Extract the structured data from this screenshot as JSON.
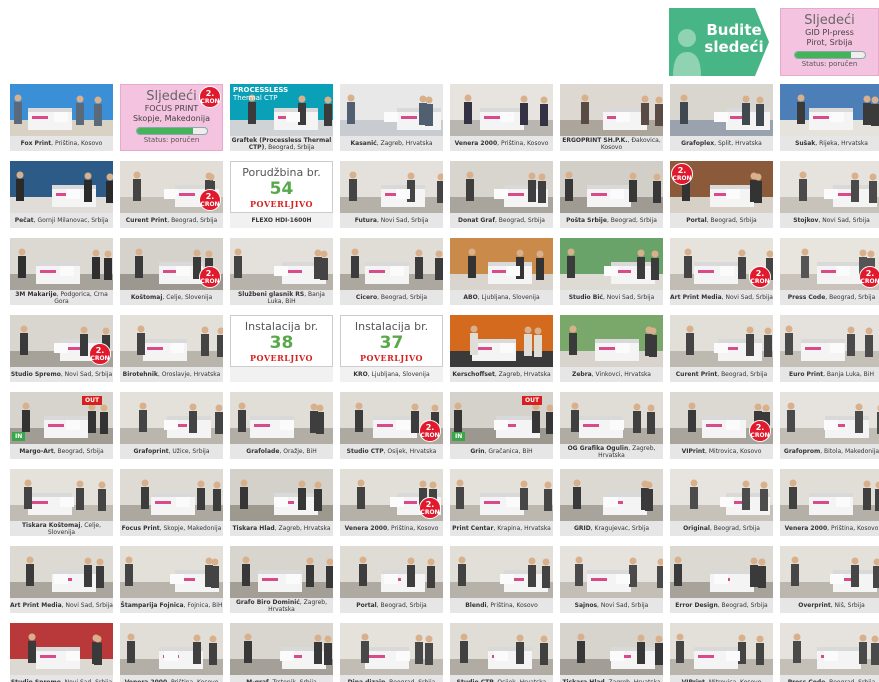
{
  "banner": {
    "line1": "Budite",
    "line2": "sledeći"
  },
  "top_pending": {
    "title": "Sljedeći",
    "name": "GID PI-press",
    "place": "Pirot, Srbija",
    "progress": 0.8,
    "status": "Status: poručen"
  },
  "badge": {
    "number": "2.",
    "text": "CRON"
  },
  "tiles": [
    {
      "type": "photo",
      "name": "Fox Print",
      "place": ", Priština, Kosovo",
      "colors": [
        "#3a8fd6",
        "#d9d2c4",
        "#5a6a7a"
      ]
    },
    {
      "type": "pending",
      "title": "Sljedeći",
      "name": "FOCUS PRINT",
      "place": "Skopje, Makedonija",
      "progress": 0.8,
      "status": "Status: poručen",
      "badge": true
    },
    {
      "type": "photo",
      "name": "Graftek (Processless Thermal CTP)",
      "place": ", Beograd, Srbija",
      "colors": [
        "#0aa1b8",
        "#cfd3d6",
        "#3b3b3b"
      ],
      "header": "PROCESSLESS",
      "header2": "Thermal CTP"
    },
    {
      "type": "photo",
      "name": "Kasanić",
      "place": ", Zagreb, Hrvatska",
      "colors": [
        "#e8e8e8",
        "#c8ccd0",
        "#506070"
      ]
    },
    {
      "type": "photo",
      "name": "Venera 2000",
      "place": ", Priština, Kosovo",
      "colors": [
        "#e7e3de",
        "#b9b5b0",
        "#334"
      ]
    },
    {
      "type": "photo",
      "name": "ERGOPRINT SH.P.K.",
      "place": ", Đakovica, Kosovo",
      "colors": [
        "#ddd9d2",
        "#aba59b",
        "#5a4a44"
      ]
    },
    {
      "type": "photo",
      "name": "Grafoplex",
      "place": ", Split, Hrvatska",
      "colors": [
        "#d9d6cf",
        "#9aa3ad",
        "#404850"
      ]
    },
    {
      "type": "photo",
      "name": "Sušak",
      "place": ", Rijeka, Hrvatska",
      "colors": [
        "#4c7fb8",
        "#e6e2dc",
        "#3a3a3a"
      ]
    },
    {
      "type": "photo",
      "name": "Pečat",
      "place": ", Gornji Milanovac, Srbija",
      "colors": [
        "#2c5b88",
        "#e0ddd8",
        "#2a2a2a"
      ]
    },
    {
      "type": "photo",
      "name": "Curent Print",
      "place": ", Beograd, Srbija",
      "colors": [
        "#e2ded7",
        "#c6c1b8",
        "#444"
      ],
      "badge": true
    },
    {
      "type": "order",
      "title": "Porudžbina br.",
      "number": "54",
      "stamp": "POVERLJIVO",
      "name": "FLEXO HDI-1600H",
      "place": ""
    },
    {
      "type": "photo",
      "name": "Futura",
      "place": ", Novi Sad, Srbija",
      "colors": [
        "#e4e1dc",
        "#b5b0a8",
        "#444"
      ]
    },
    {
      "type": "photo",
      "name": "Donat Graf",
      "place": ", Beograd, Srbija",
      "colors": [
        "#d8d5cf",
        "#a9a49c",
        "#3f3f3f"
      ]
    },
    {
      "type": "photo",
      "name": "Pošta Srbije",
      "place": ", Beograd, Srbija",
      "colors": [
        "#d2cfc9",
        "#9f9a92",
        "#373737"
      ]
    },
    {
      "type": "photo",
      "name": "Portal",
      "place": ", Beograd, Srbija",
      "colors": [
        "#8a5a3a",
        "#d6d0c6",
        "#333"
      ],
      "badge": true,
      "badgeLeft": true
    },
    {
      "type": "photo",
      "name": "Stojkov",
      "place": ", Novi Sad, Srbija",
      "colors": [
        "#e6e3de",
        "#c7c2ba",
        "#4a4a4a"
      ]
    },
    {
      "type": "photo",
      "name": "3M Makarije",
      "place": ", Podgorica, Crna Gora",
      "colors": [
        "#dcd9d3",
        "#a7a29a",
        "#2f2f2f"
      ]
    },
    {
      "type": "photo",
      "name": "Koštomaj",
      "place": ", Celje, Slovenija",
      "colors": [
        "#d5d2cc",
        "#9c978f",
        "#3a3a3a"
      ],
      "badge": true
    },
    {
      "type": "photo",
      "name": "Službeni glasnik RS",
      "place": ", Banja Luka, BiH",
      "colors": [
        "#e4e1dc",
        "#b7b2aa",
        "#444"
      ]
    },
    {
      "type": "photo",
      "name": "Cicero",
      "place": ", Beograd, Srbija",
      "colors": [
        "#e0ddd7",
        "#aca79f",
        "#3c3c3c"
      ]
    },
    {
      "type": "photo",
      "name": "ABO",
      "place": ", Ljubljana, Slovenija",
      "colors": [
        "#c98a4a",
        "#d9d5ce",
        "#333"
      ]
    },
    {
      "type": "photo",
      "name": "Studio Bić",
      "place": ", Novi Sad, Srbija",
      "colors": [
        "#6aa36a",
        "#dedbd4",
        "#3b3b3b"
      ]
    },
    {
      "type": "photo",
      "name": "Art Print Media",
      "place": ", Novi Sad, Srbija",
      "colors": [
        "#e6e2dc",
        "#c1bcb4",
        "#444"
      ],
      "badge": true
    },
    {
      "type": "photo",
      "name": "Press Code",
      "place": ", Beograd, Srbija",
      "colors": [
        "#e8e4de",
        "#c9c3bb",
        "#555"
      ],
      "badge": true
    },
    {
      "type": "photo",
      "name": "Studio Spremo",
      "place": ", Novi Sad, Srbija",
      "colors": [
        "#d9d5cf",
        "#a6a199",
        "#3a3a3a"
      ],
      "badge": true
    },
    {
      "type": "photo",
      "name": "Birotehnik",
      "place": ", Oroslavje, Hrvatska",
      "colors": [
        "#e3e0da",
        "#b9b4ac",
        "#444"
      ]
    },
    {
      "type": "order",
      "title": "Instalacija br.",
      "number": "38",
      "stamp": "POVERLJIVO",
      "name": "",
      "place": ""
    },
    {
      "type": "order",
      "title": "Instalacija br.",
      "number": "37",
      "stamp": "POVERLJIVO",
      "name": "KRO",
      "place": ", Ljubljana, Slovenija"
    },
    {
      "type": "photo",
      "name": "Kerschoffset",
      "place": ", Zagreb, Hrvatska",
      "colors": [
        "#d36a1e",
        "#3a3a3a",
        "#e0ddd6"
      ]
    },
    {
      "type": "photo",
      "name": "Zebra",
      "place": ", Vinkovci, Hrvatska",
      "colors": [
        "#7aa86a",
        "#d8d4cd",
        "#3a3a3a"
      ]
    },
    {
      "type": "photo",
      "name": "Curent Print",
      "place": ", Beograd, Srbija",
      "colors": [
        "#e2dfd9",
        "#bdb8b0",
        "#444"
      ]
    },
    {
      "type": "photo",
      "name": "Euro Print",
      "place": ", Banja Luka, BiH",
      "colors": [
        "#e5e2dd",
        "#c4bfb7",
        "#4a4a4a"
      ]
    },
    {
      "type": "photo",
      "name": "Margo-Art",
      "place": ", Beograd, Srbija",
      "colors": [
        "#d7d3cd",
        "#a19c94",
        "#333"
      ],
      "io": true
    },
    {
      "type": "photo",
      "name": "Grafoprint",
      "place": ", Užice, Srbija",
      "colors": [
        "#e4e1db",
        "#bab5ad",
        "#444"
      ]
    },
    {
      "type": "photo",
      "name": "Grafolade",
      "place": ", Oražje, BiH",
      "colors": [
        "#e1ded8",
        "#b2ada5",
        "#3e3e3e"
      ]
    },
    {
      "type": "photo",
      "name": "Studio CTP",
      "place": ", Osijek, Hrvatska",
      "colors": [
        "#dfdcd6",
        "#aea9a1",
        "#3c3c3c"
      ],
      "badge": true
    },
    {
      "type": "photo",
      "name": "Grin",
      "place": ", Gračanica, BiH",
      "colors": [
        "#d5d1cb",
        "#9d988f",
        "#363636"
      ],
      "io": true
    },
    {
      "type": "photo",
      "name": "OG Grafika Ogulin",
      "place": ", Zagreb, Hrvatska",
      "colors": [
        "#e0ddd7",
        "#b0aba3",
        "#404040"
      ]
    },
    {
      "type": "photo",
      "name": "VIPrint",
      "place": ", Mitrovica, Kosovo",
      "colors": [
        "#dcd8d2",
        "#a9a49c",
        "#3a3a3a"
      ],
      "badge": true
    },
    {
      "type": "photo",
      "name": "Grafoprom",
      "place": ", Bitola, Makedonija",
      "colors": [
        "#e6e3de",
        "#c2bdb5",
        "#4a4a4a"
      ]
    },
    {
      "type": "photo",
      "name": "Tiskara Koštomaj",
      "place": ", Celje, Slovenija",
      "colors": [
        "#e5e2dc",
        "#c0bbb3",
        "#444"
      ]
    },
    {
      "type": "photo",
      "name": "Focus Print",
      "place": ", Skopje, Makedonija",
      "colors": [
        "#dedad4",
        "#aca79f",
        "#3c3c3c"
      ]
    },
    {
      "type": "photo",
      "name": "Tiskara Hlad",
      "place": ", Zagreb, Hrvatska",
      "colors": [
        "#d4d0ca",
        "#9e998f",
        "#363636"
      ]
    },
    {
      "type": "photo",
      "name": "Venera 2000",
      "place": ", Priština, Kosovo",
      "colors": [
        "#e2dfd9",
        "#b5b0a8",
        "#424242"
      ],
      "badge": true
    },
    {
      "type": "photo",
      "name": "Print Centar",
      "place": ", Krapina, Hrvatska",
      "colors": [
        "#e4e1db",
        "#bcb7af",
        "#464646"
      ]
    },
    {
      "type": "photo",
      "name": "GRID",
      "place": ", Kragujevac, Srbija",
      "colors": [
        "#dcd9d3",
        "#a8a39b",
        "#3a3a3a"
      ]
    },
    {
      "type": "photo",
      "name": "Original",
      "place": ", Beograd, Srbija",
      "colors": [
        "#e7e4df",
        "#c6c1b9",
        "#4c4c4c"
      ]
    },
    {
      "type": "photo",
      "name": "Venera 2000",
      "place": ", Priština, Kosovo",
      "colors": [
        "#e1ded8",
        "#b4afa7",
        "#404040"
      ]
    },
    {
      "type": "photo",
      "name": "Art Print Media",
      "place": ", Novi Sad, Srbija",
      "colors": [
        "#ddd9d3",
        "#aaa59d",
        "#3b3b3b"
      ]
    },
    {
      "type": "photo",
      "name": "Štamparija Fojnica",
      "place": ", Fojnica, BiH",
      "colors": [
        "#e3e0da",
        "#b8b3ab",
        "#444"
      ]
    },
    {
      "type": "photo",
      "name": "Grafo Biro Dominić",
      "place": ", Zagreb, Hrvatska",
      "colors": [
        "#d8d4ce",
        "#a39e96",
        "#383838"
      ]
    },
    {
      "type": "photo",
      "name": "Portal",
      "place": ", Beograd, Srbija",
      "colors": [
        "#dfdbd5",
        "#aea9a1",
        "#3e3e3e"
      ]
    },
    {
      "type": "photo",
      "name": "Blendi",
      "place": ", Priština, Kosovo",
      "colors": [
        "#e2dfd9",
        "#b6b1a9",
        "#424242"
      ]
    },
    {
      "type": "photo",
      "name": "Sajnos",
      "place": ", Novi Sad, Srbija",
      "colors": [
        "#e6e3de",
        "#c3beb6",
        "#4a4a4a"
      ]
    },
    {
      "type": "photo",
      "name": "Error Design",
      "place": ", Beograd, Srbija",
      "colors": [
        "#dcd8d2",
        "#a7a29a",
        "#3a3a3a"
      ]
    },
    {
      "type": "photo",
      "name": "Overprint",
      "place": ", Niš, Srbija",
      "colors": [
        "#e4e1db",
        "#bbb6ae",
        "#464646"
      ]
    },
    {
      "type": "photo",
      "name": "Studio Spremo",
      "place": ", Novi Sad, Srbija",
      "colors": [
        "#b9383a",
        "#dcd8d2",
        "#3a3a3a"
      ]
    },
    {
      "type": "photo",
      "name": "Venera 2000",
      "place": ", Priština, Kosovo",
      "colors": [
        "#e1ded8",
        "#b3aea6",
        "#404040"
      ]
    },
    {
      "type": "photo",
      "name": "M-graf",
      "place": ", Trstenik, Srbija",
      "colors": [
        "#d9d5cf",
        "#a4a097",
        "#383838"
      ]
    },
    {
      "type": "photo",
      "name": "Dina dizajn",
      "place": ", Beograd, Srbija",
      "colors": [
        "#e5e2dc",
        "#c1bcb4",
        "#484848"
      ]
    },
    {
      "type": "photo",
      "name": "Studio CTP",
      "place": ", Osijek, Hrvatska",
      "colors": [
        "#e0ddd7",
        "#b0aba3",
        "#404040"
      ]
    },
    {
      "type": "photo",
      "name": "Tiskara Hlad",
      "place": ", Zagreb, Hrvatska",
      "colors": [
        "#d7d3cd",
        "#a29d95",
        "#373737"
      ]
    },
    {
      "type": "photo",
      "name": "VIPrint",
      "place": ", Mitrovica, Kosovo",
      "colors": [
        "#e3e0da",
        "#b9b4ac",
        "#444"
      ]
    },
    {
      "type": "photo",
      "name": "Press Code",
      "place": ", Beograd, Srbija",
      "colors": [
        "#e6e3de",
        "#c4bfb7",
        "#4a4a4a"
      ]
    }
  ],
  "io": {
    "in": "IN",
    "out": "OUT"
  }
}
